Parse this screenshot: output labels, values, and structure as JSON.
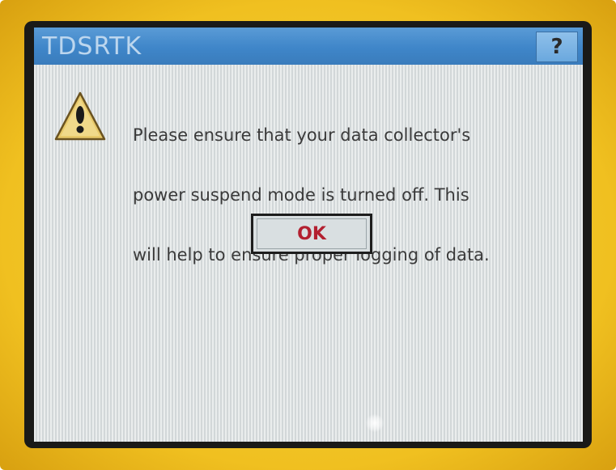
{
  "window": {
    "title": "TDSRTK",
    "help_label": "?"
  },
  "dialog": {
    "icon": "warning-icon",
    "message_lines": [
      "Please ensure that your data collector's",
      "power suspend mode is turned off.  This",
      "will help to ensure proper logging of data."
    ],
    "ok_label": "OK"
  },
  "colors": {
    "title_bar": "#3f86c9",
    "ok_text": "#b32030",
    "bezel": "#f0c020"
  }
}
